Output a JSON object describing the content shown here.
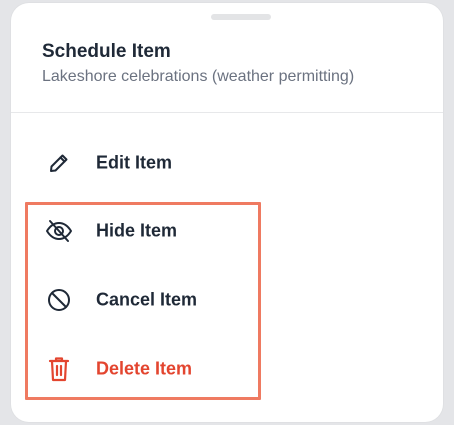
{
  "sheet": {
    "title": "Schedule Item",
    "subtitle": "Lakeshore celebrations (weather permitting)"
  },
  "menu": {
    "items": [
      {
        "label": "Edit Item",
        "icon": "pencil-icon"
      },
      {
        "label": "Hide Item",
        "icon": "eye-off-icon"
      },
      {
        "label": "Cancel Item",
        "icon": "prohibited-icon"
      },
      {
        "label": "Delete Item",
        "icon": "trash-icon"
      }
    ]
  },
  "colors": {
    "text": "#1f2937",
    "subtext": "#6b7280",
    "danger": "#e3452f",
    "highlight": "#ef7a61"
  }
}
